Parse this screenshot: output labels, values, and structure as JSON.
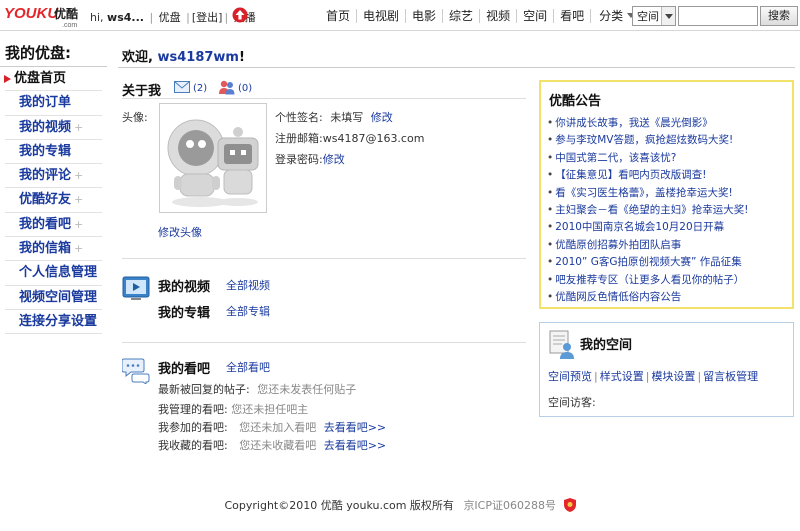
{
  "header": {
    "logo_text": "YOUKU优酷",
    "logo_sub": ".com",
    "greeting": "hi,",
    "username_short": "ws4...",
    "user_links": [
      "优盘",
      "登出",
      "点播"
    ],
    "nav": [
      "首页",
      "电视剧",
      "电影",
      "综艺",
      "视频",
      "空间",
      "看吧",
      "分类"
    ],
    "search_scope": "空间",
    "search_value": "",
    "search_button": "搜索"
  },
  "sidebar": {
    "title": "我的优盘:",
    "items": [
      {
        "label": "优盘首页",
        "active": true,
        "plus": ""
      },
      {
        "label": "我的订单",
        "active": false,
        "plus": ""
      },
      {
        "label": "我的视频",
        "active": false,
        "plus": "+"
      },
      {
        "label": "我的专辑",
        "active": false,
        "plus": ""
      },
      {
        "label": "我的评论",
        "active": false,
        "plus": "+"
      },
      {
        "label": "优酷好友",
        "active": false,
        "plus": "+"
      },
      {
        "label": "我的看吧",
        "active": false,
        "plus": "+"
      },
      {
        "label": "我的信箱",
        "active": false,
        "plus": "+"
      },
      {
        "label": "个人信息管理",
        "active": false,
        "plus": "+"
      },
      {
        "label": "视频空间管理",
        "active": false,
        "plus": "+"
      },
      {
        "label": "连接分享设置",
        "active": false,
        "plus": ""
      }
    ]
  },
  "main": {
    "welcome_prefix": "欢迎,",
    "welcome_user": "ws4187wm",
    "welcome_suffix": "!",
    "about_title": "关于我",
    "mail_count": "(2)",
    "friend_count": "(0)",
    "avatar_label": "头像:",
    "edit_avatar": "修改头像",
    "signature_label": "个性签名:",
    "signature_value": "未填写",
    "signature_edit": "修改",
    "email_label": "注册邮箱:",
    "email_value": "ws4187@163.com",
    "password_label": "登录密码:",
    "password_edit": "修改",
    "videos_title": "我的视频",
    "videos_link": "全部视频",
    "albums_title": "我的专辑",
    "albums_link": "全部专辑",
    "tieba_title": "我的看吧",
    "tieba_link": "全部看吧",
    "tieba_rows": [
      {
        "label": "最新被回复的帖子:",
        "value": "您还未发表任何贴子",
        "link": ""
      },
      {
        "label": "我管理的看吧:",
        "value": "您还未担任吧主",
        "link": ""
      },
      {
        "label": "我参加的看吧:",
        "value": "您还未加入看吧",
        "link": "去看看吧>>"
      },
      {
        "label": "我收藏的看吧:",
        "value": "您还未收藏看吧",
        "link": "去看看吧>>"
      }
    ]
  },
  "notice": {
    "title": "优酷公告",
    "items": [
      "你讲成长故事，我送《晨光倒影》",
      "参与李玟MV答题，疯抢超炫数码大奖!",
      "中国式第二代，该喜该忧?",
      "【征集意见】看吧内页改版调查!",
      "看《实习医生格蕾》，盖楼抢幸运大奖!",
      "主妇聚会－看《绝望的主妇》抢幸运大奖!",
      "2010中国南京名城会10月20日开幕",
      "优酷原创招募外拍团队启事",
      "2010” G客G拍原创视频大赛” 作品征集",
      "吧友推荐专区（让更多人看见你的帖子）",
      "优酷网反色情低俗内容公告"
    ]
  },
  "space": {
    "title": "我的空间",
    "links": [
      "空间预览",
      "样式设置",
      "模块设置",
      "留言板管理"
    ],
    "visitors_label": "空间访客:"
  },
  "footer": {
    "copyright": "Copyright©2010 优酷  youku.com 版权所有",
    "icp": "京ICP证060288号"
  },
  "colors": {
    "link": "#1a3a9e",
    "notice_border": "#f3e26a",
    "space_border": "#b9cfe6",
    "active_arrow": "#d8202b"
  }
}
